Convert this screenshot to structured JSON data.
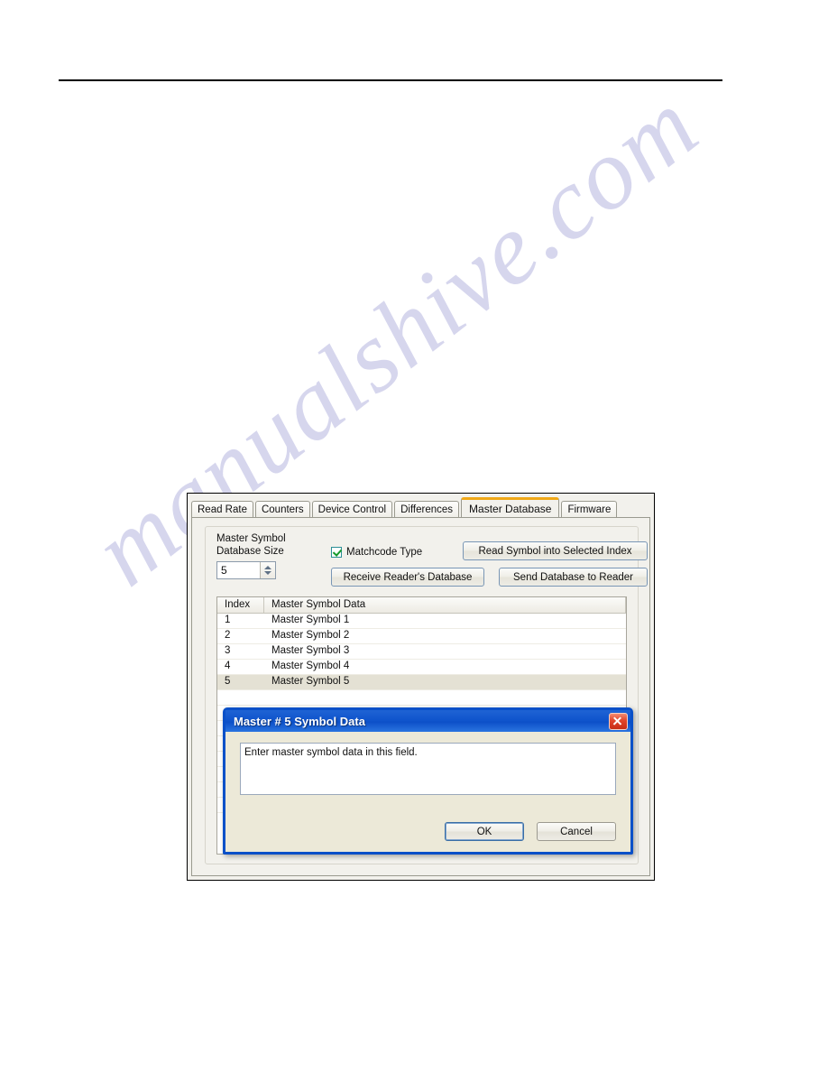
{
  "page": {
    "watermark_text": "manualshive.com"
  },
  "app_window": {
    "tabs": [
      {
        "label": "Read Rate",
        "active": false
      },
      {
        "label": "Counters",
        "active": false
      },
      {
        "label": "Device Control",
        "active": false
      },
      {
        "label": "Differences",
        "active": false
      },
      {
        "label": "Master Database",
        "active": true
      },
      {
        "label": "Firmware",
        "active": false
      }
    ],
    "active_tab_accent": "#f0a818",
    "master_database": {
      "db_size_label_line1": "Master Symbol",
      "db_size_label_line2": "Database Size",
      "db_size_value": "5",
      "matchcode_label": "Matchcode Type",
      "matchcode_checked": true,
      "buttons": {
        "read_symbol": "Read Symbol into Selected Index",
        "receive_db": "Receive Reader's Database",
        "send_db": "Send Database to Reader"
      },
      "table": {
        "columns": [
          "Index",
          "Master Symbol Data"
        ],
        "rows": [
          {
            "index": "1",
            "symbol": "Master Symbol 1",
            "selected": false
          },
          {
            "index": "2",
            "symbol": "Master Symbol 2",
            "selected": false
          },
          {
            "index": "3",
            "symbol": "Master Symbol 3",
            "selected": false
          },
          {
            "index": "4",
            "symbol": "Master Symbol 4",
            "selected": false
          },
          {
            "index": "5",
            "symbol": "Master Symbol 5",
            "selected": true
          },
          {
            "index": "",
            "symbol": "",
            "selected": false
          },
          {
            "index": "",
            "symbol": "",
            "selected": false
          },
          {
            "index": "",
            "symbol": "",
            "selected": false
          },
          {
            "index": "",
            "symbol": "",
            "selected": false
          },
          {
            "index": "",
            "symbol": "",
            "selected": false
          },
          {
            "index": "",
            "symbol": "",
            "selected": false
          },
          {
            "index": "",
            "symbol": "",
            "selected": false
          },
          {
            "index": "",
            "symbol": "",
            "selected": false
          }
        ]
      }
    }
  },
  "dialog": {
    "title": "Master # 5 Symbol Data",
    "textarea_value": "Enter master symbol data in this field.",
    "ok_label": "OK",
    "cancel_label": "Cancel",
    "close_icon": "close-icon",
    "titlebar_color": "#0c4fc8"
  }
}
